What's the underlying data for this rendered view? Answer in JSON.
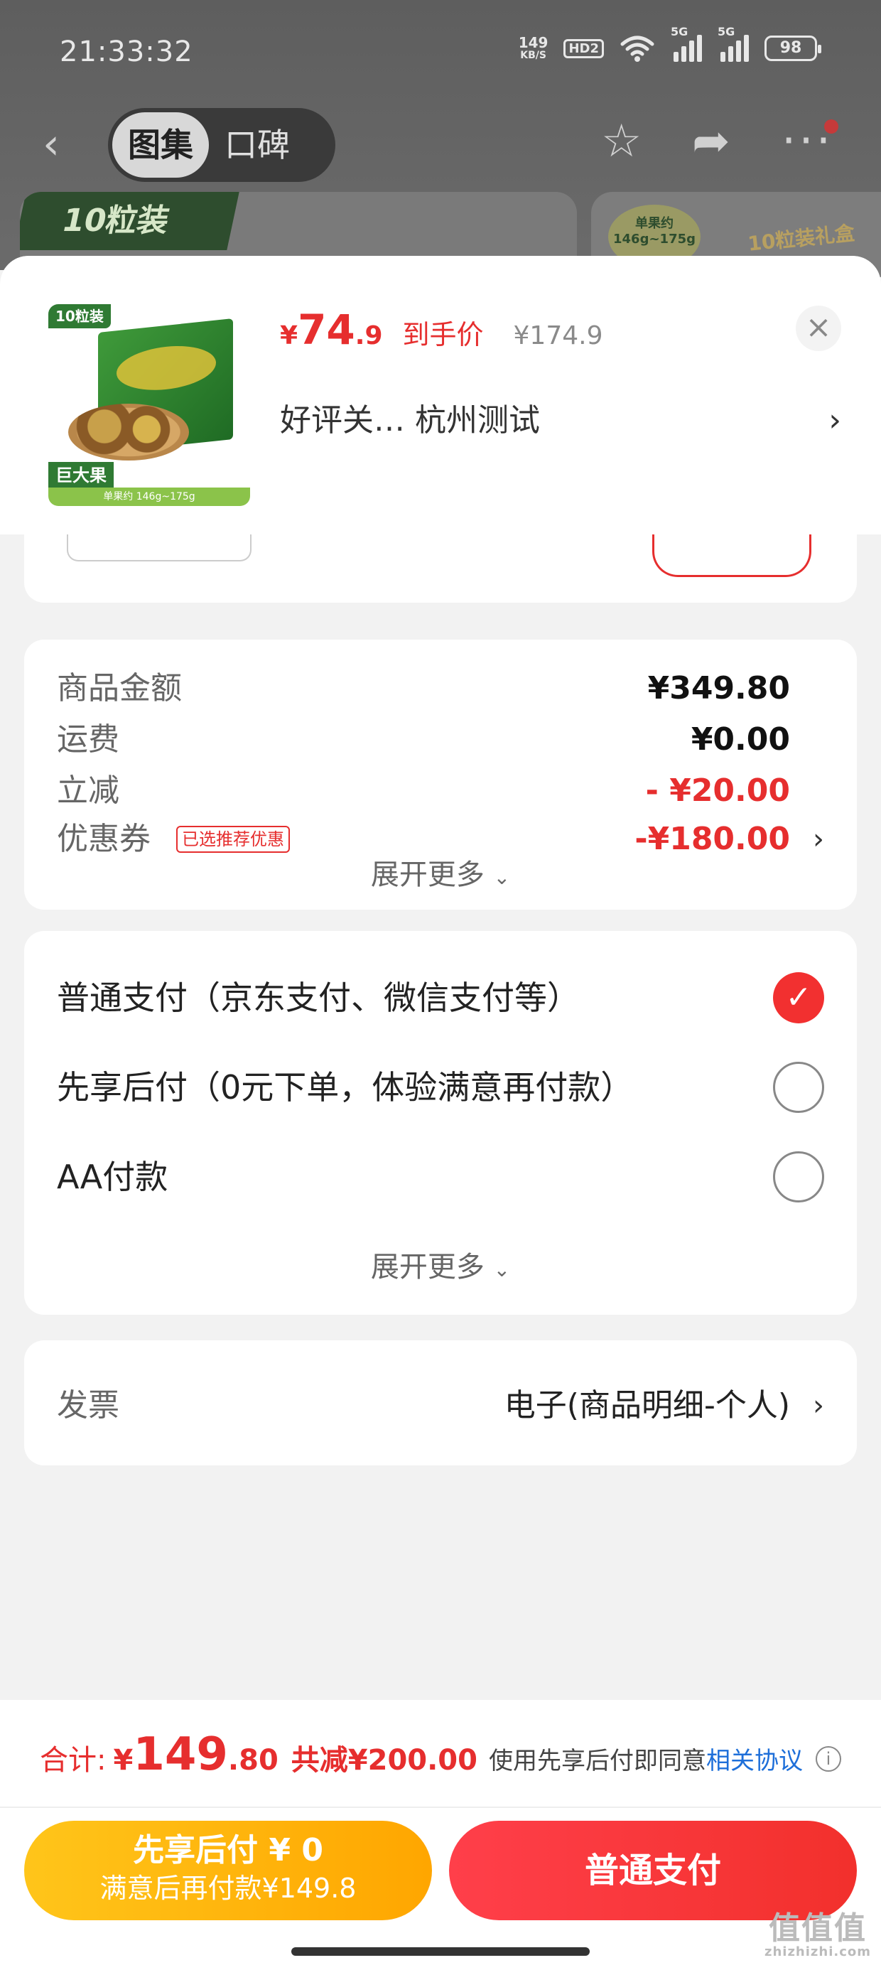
{
  "status_bar": {
    "time": "21:33:32",
    "net_speed_value": "149",
    "net_speed_unit": "KB/S",
    "hd_badge": "HD2",
    "signal_label": "5G",
    "battery": "98"
  },
  "nav": {
    "tabs": [
      {
        "label": "图集",
        "active": true
      },
      {
        "label": "口碑",
        "active": false
      }
    ]
  },
  "background": {
    "banner_tag": "10粒装",
    "right_oval_line1": "单果约",
    "right_oval_line2": "146g~175g",
    "right_gift": "10粒装礼盒"
  },
  "product": {
    "thumb_tag": "10粒装",
    "thumb_badge": "巨大果",
    "thumb_strip": "单果约 146g~175g",
    "price_currency": "¥",
    "price_int": "74",
    "price_dec": ".9",
    "price_label": "到手价",
    "original_price": "¥174.9",
    "selection_text": "好评关…  杭州测试"
  },
  "summary": {
    "rows": [
      {
        "key": "商品金额",
        "value": "¥349.80",
        "red": false
      },
      {
        "key": "运费",
        "value": "¥0.00",
        "red": false
      },
      {
        "key": "立减",
        "value": "- ¥20.00",
        "red": true
      },
      {
        "key": "优惠券",
        "value": "-¥180.00",
        "red": true,
        "badge": "已选推荐优惠"
      }
    ],
    "expand_label": "展开更多"
  },
  "payment": {
    "options": [
      {
        "label": "普通支付（京东支付、微信支付等）",
        "checked": true
      },
      {
        "label": "先享后付（0元下单，体验满意再付款）",
        "checked": false
      },
      {
        "label": "AA付款",
        "checked": false
      }
    ],
    "expand_label": "展开更多"
  },
  "invoice": {
    "key": "发票",
    "value": "电子(商品明细-个人)"
  },
  "footer": {
    "total_label": "合计:",
    "total_currency": "¥",
    "total_int": "149",
    "total_dec": ".80",
    "total_saved": "共减¥200.00",
    "agree_text": "使用先享后付即同意",
    "agree_link": "相关协议",
    "btn_later_line1": "先享后付 ¥ 0",
    "btn_later_line2": "满意后再付款¥149.8",
    "btn_pay": "普通支付"
  },
  "watermark": {
    "line1": "值值值",
    "line2": "zhizhizhi.com"
  },
  "colors": {
    "accent_red": "#e62e2e",
    "pay_button": "#f2302c",
    "later_button": "#ffb20d",
    "link_blue": "#1e6fd9"
  }
}
